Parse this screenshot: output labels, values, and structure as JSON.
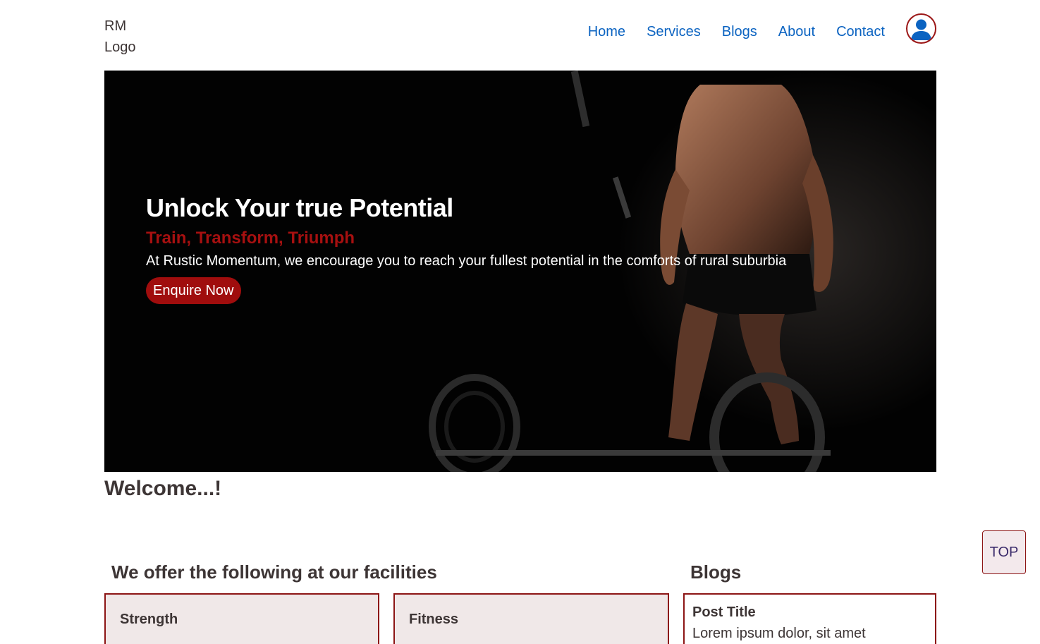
{
  "header": {
    "logo_line1": "RM",
    "logo_line2": "Logo",
    "nav": [
      {
        "label": "Home"
      },
      {
        "label": "Services"
      },
      {
        "label": "Blogs"
      },
      {
        "label": "About"
      },
      {
        "label": "Contact"
      }
    ],
    "avatar_icon": "user-circle-icon"
  },
  "hero": {
    "title": "Unlock Your true Potential",
    "subtitle": "Train, Transform, Triumph",
    "text": "At Rustic Momentum, we encourage you to reach your fullest potential in the comforts of rural suburbia",
    "cta_label": "Enquire Now"
  },
  "welcome": {
    "heading": "Welcome...!"
  },
  "facilities": {
    "heading": "We offer the following at our facilities",
    "items": [
      {
        "label": "Strength"
      },
      {
        "label": "Fitness"
      }
    ]
  },
  "blogs": {
    "heading": "Blogs",
    "post_title": "Post Title",
    "post_excerpt": "Lorem ipsum dolor, sit amet"
  },
  "scroll_top": {
    "label": "TOP"
  },
  "colors": {
    "link": "#0b63c1",
    "accent_red": "#a00d0d",
    "card_bg": "#f0e8e8",
    "card_border": "#8c1515",
    "text": "#3d3535"
  }
}
